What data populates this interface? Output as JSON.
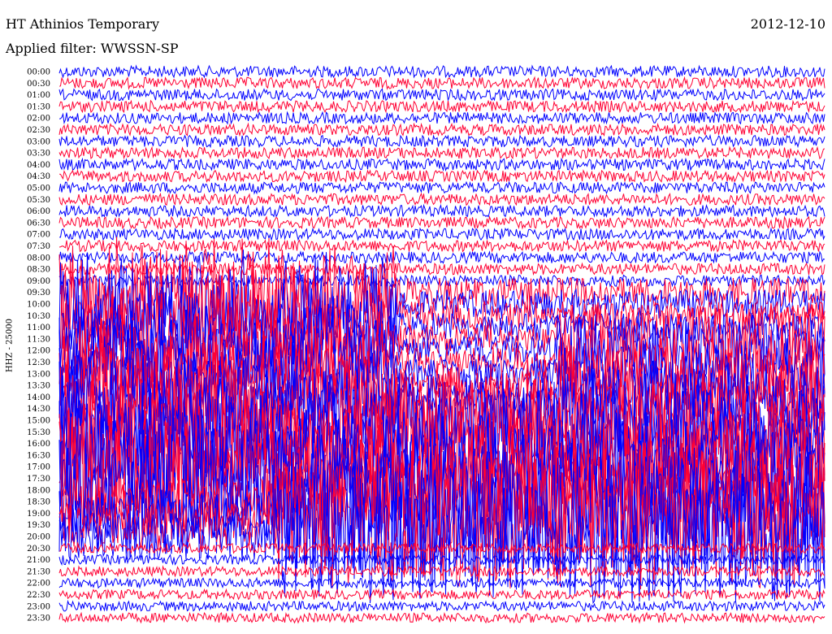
{
  "header": {
    "station": "HT Athinios Temporary",
    "date": "2012-12-10",
    "filter_label": "Applied filter: WWSSN-SP"
  },
  "channel_label": "HHZ - 25000",
  "colors": {
    "trace_a": "#0000ff",
    "trace_b": "#ff0033",
    "background": "#ffffff",
    "text": "#000000"
  },
  "chart_data": {
    "type": "line",
    "title": "HT Athinios Temporary",
    "subtitle": "Applied filter: WWSSN-SP",
    "ylabel": "HHZ - 25000",
    "row_labels": [
      "00:00",
      "00:30",
      "01:00",
      "01:30",
      "02:00",
      "02:30",
      "03:00",
      "03:30",
      "04:00",
      "04:30",
      "05:00",
      "05:30",
      "06:00",
      "06:30",
      "07:00",
      "07:30",
      "08:00",
      "08:30",
      "09:00",
      "09:30",
      "10:00",
      "10:30",
      "11:00",
      "11:30",
      "12:00",
      "12:30",
      "13:00",
      "13:30",
      "14:00",
      "14:30",
      "15:00",
      "15:30",
      "16:00",
      "16:30",
      "17:00",
      "17:30",
      "18:00",
      "18:30",
      "19:00",
      "19:30",
      "20:00",
      "20:30",
      "21:00",
      "21:30",
      "22:00",
      "22:30",
      "23:00",
      "23:30"
    ],
    "row_colors": [
      "#0000ff",
      "#ff0033"
    ],
    "grid": false,
    "legend": "none"
  }
}
